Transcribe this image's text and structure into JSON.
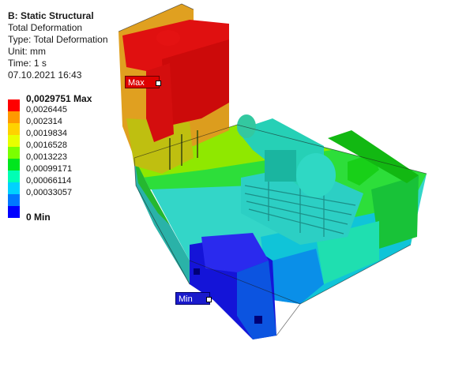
{
  "info": {
    "title": "B: Static Structural",
    "lines": [
      "Total Deformation",
      "Type: Total Deformation",
      "Unit: mm",
      "Time: 1 s",
      "07.10.2021 16:43"
    ]
  },
  "legend": {
    "entries": [
      {
        "label": "0,0029751 Max",
        "color": "#ff0000",
        "bold": true
      },
      {
        "label": "0,0026445",
        "color": "#ff9900",
        "bold": false
      },
      {
        "label": "0,002314",
        "color": "#ffd200",
        "bold": false
      },
      {
        "label": "0,0019834",
        "color": "#e8ff00",
        "bold": false
      },
      {
        "label": "0,0016528",
        "color": "#7bff00",
        "bold": false
      },
      {
        "label": "0,0013223",
        "color": "#00e61e",
        "bold": false
      },
      {
        "label": "0,00099171",
        "color": "#00ffb4",
        "bold": false
      },
      {
        "label": "0,00066114",
        "color": "#00d2ff",
        "bold": false
      },
      {
        "label": "0,00033057",
        "color": "#0078ff",
        "bold": false
      },
      {
        "label": "0 Min",
        "color": "#0000ff",
        "bold": true
      }
    ]
  },
  "probes": {
    "max": {
      "label": "Max",
      "color": "#dd0000"
    },
    "min": {
      "label": "Min",
      "color": "#1a1acc"
    }
  }
}
